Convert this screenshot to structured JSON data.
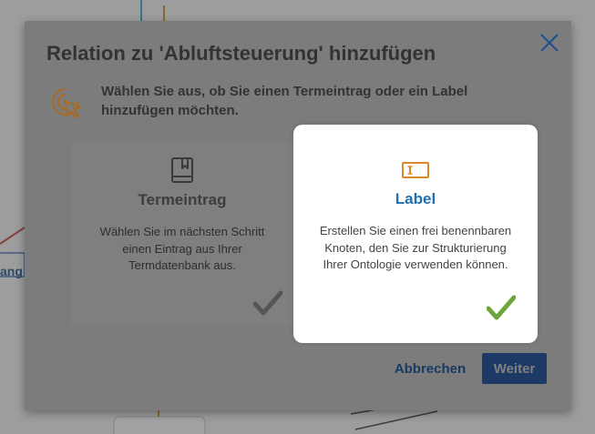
{
  "background": {
    "node_label": "ang"
  },
  "dialog": {
    "title": "Relation zu 'Abluftsteuerung' hinzufügen",
    "instruction": "Wählen Sie aus, ob Sie einen Termeintrag oder ein Label hinzufügen möchten.",
    "icons": {
      "close": "close-icon",
      "info": "cursor-click-icon"
    },
    "options": [
      {
        "title": "Termeintrag",
        "description": "Wählen Sie im nächsten Schritt einen Eintrag aus Ihrer Termdatenbank aus.",
        "icon": "book-icon",
        "selected": false
      },
      {
        "title": "Label",
        "description": "Erstellen Sie einen frei benennbaren Knoten, den Sie zur Strukturierung Ihrer Ontologie verwenden können.",
        "icon": "label-tag-icon",
        "selected": true
      }
    ],
    "buttons": {
      "cancel": "Abbrechen",
      "next": "Weiter"
    }
  },
  "colors": {
    "accent_blue": "#1f6fb2",
    "primary_button": "#1d3a66",
    "selected_check": "#6ea63a",
    "unselected_check": "#555555",
    "icon_orange": "#d88a2b"
  }
}
